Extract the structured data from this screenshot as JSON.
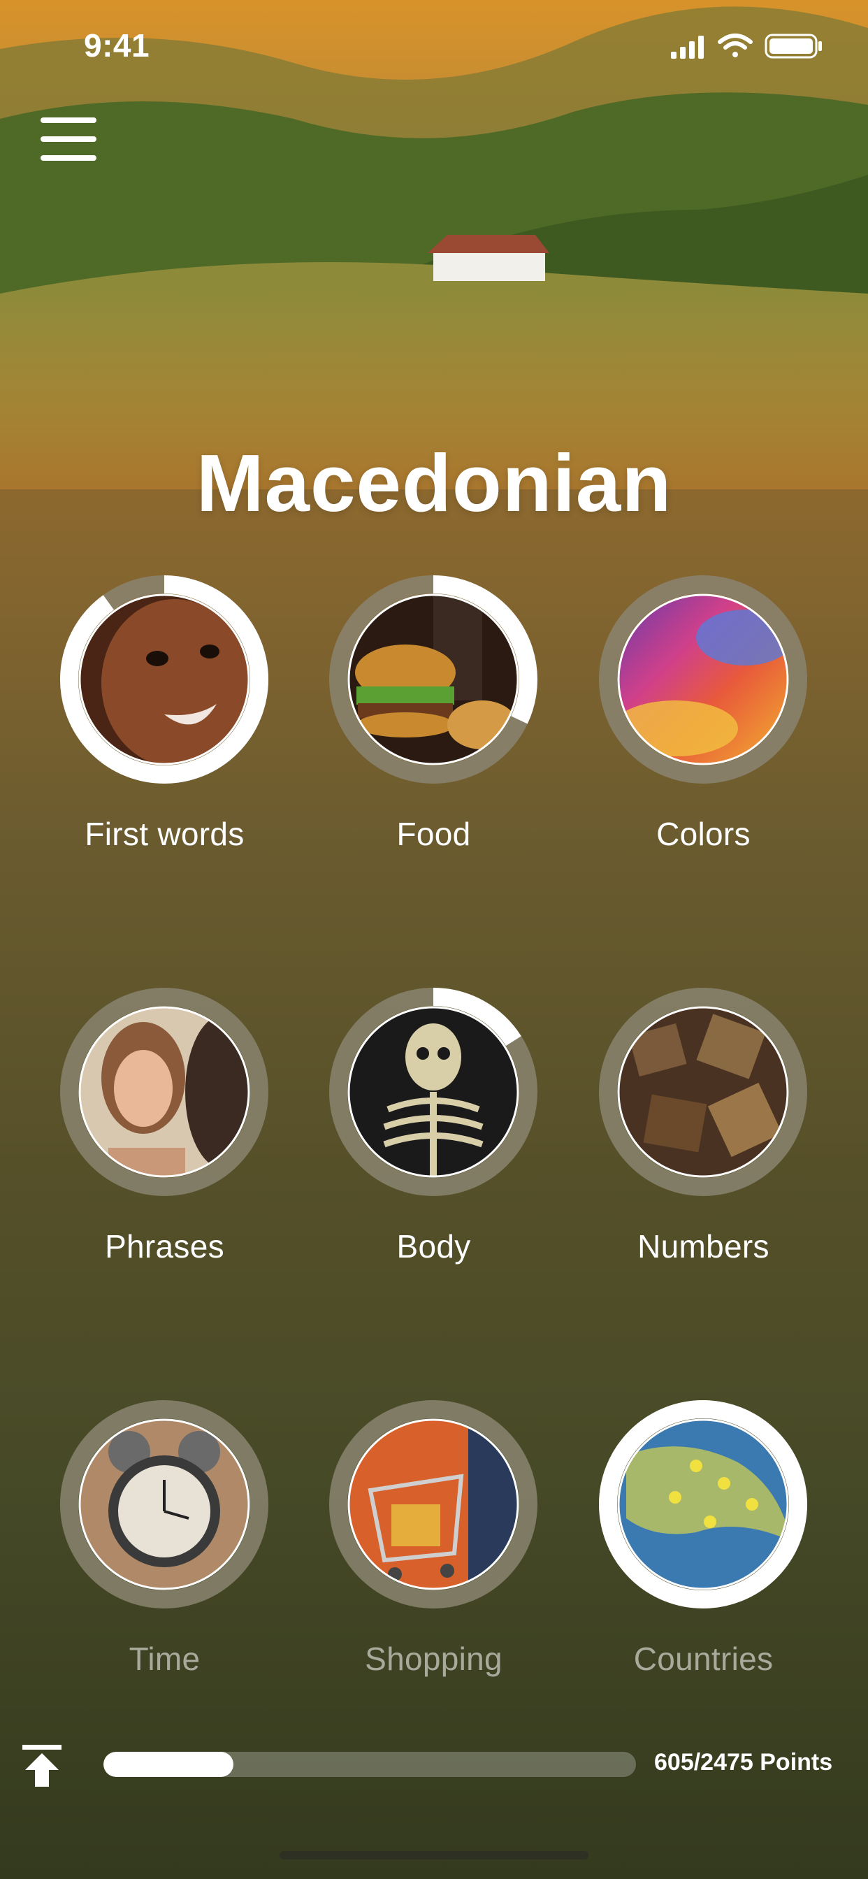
{
  "status_bar": {
    "time": "9:41",
    "icons": [
      "signal-icon",
      "wifi-icon",
      "battery-icon"
    ]
  },
  "menu": {
    "icon": "hamburger-menu-icon"
  },
  "title": "Macedonian",
  "topics": [
    {
      "label": "First words",
      "image": "baby-face",
      "progress": 0.9,
      "locked": false
    },
    {
      "label": "Food",
      "image": "burger-and-fries",
      "progress": 0.32,
      "locked": false
    },
    {
      "label": "Colors",
      "image": "color-powder",
      "progress": 0,
      "locked": false
    },
    {
      "label": "Phrases",
      "image": "smiling-couple",
      "progress": 0,
      "locked": false
    },
    {
      "label": "Body",
      "image": "skeleton",
      "progress": 0.16,
      "locked": false
    },
    {
      "label": "Numbers",
      "image": "wooden-numbers",
      "progress": 0,
      "locked": false
    },
    {
      "label": "Time",
      "image": "alarm-clock",
      "progress": 0,
      "locked": true
    },
    {
      "label": "Shopping",
      "image": "shopping-cart",
      "progress": 0,
      "locked": true
    },
    {
      "label": "Countries",
      "image": "world-map-pins",
      "progress": 1.0,
      "locked": true
    }
  ],
  "footer": {
    "upload_icon": "upload-arrow-icon",
    "points_text": "605/2475 Points",
    "progress": 0.244
  },
  "colors": {
    "ring_track": "#8a8470",
    "ring_fill": "#ffffff",
    "photo_border": "#ffffff"
  }
}
